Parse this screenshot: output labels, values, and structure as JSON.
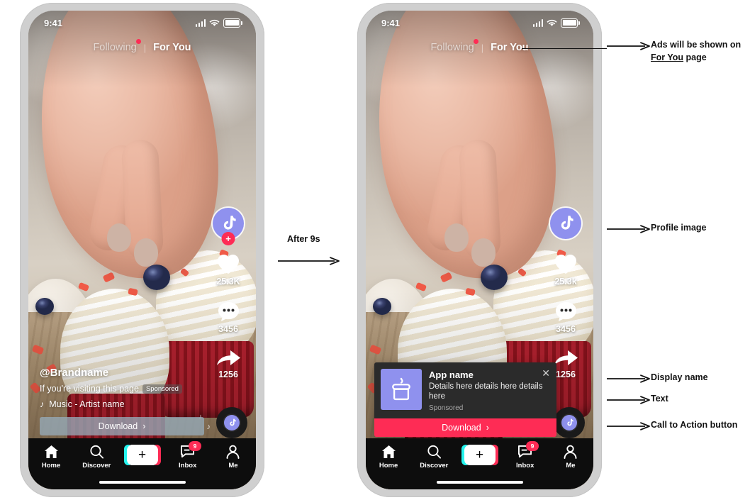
{
  "title": "TikTok in-feed ad spec mockup",
  "transition": {
    "label": "After 9s"
  },
  "phones": [
    {
      "id": "before",
      "status_bar": {
        "time": "9:41",
        "signal_icon": "signal-bars-icon",
        "wifi_icon": "wifi-icon",
        "battery_icon": "battery-icon"
      },
      "top_tabs": {
        "inactive": "Following",
        "separator": "|",
        "active": "For You",
        "badge_dot": true
      },
      "rail": {
        "avatar_icon": "tiktok-note-icon",
        "follow_plus": "+",
        "like_icon": "heart-icon",
        "like_count": "25.3K",
        "comment_icon": "comment-dots-icon",
        "comment_count": "3456",
        "share_icon": "share-arrow-icon",
        "share_count": "1256",
        "disc_icon": "music-disc-icon"
      },
      "caption": {
        "username": "@Brandname",
        "description": "If you're visiting this page",
        "sponsored_tag": "Sponsored",
        "music_icon": "music-note-icon",
        "music": "Music - Artist name",
        "cta_label": "Download",
        "cta_chevron": "›"
      },
      "ad_card": null
    },
    {
      "id": "after",
      "status_bar": {
        "time": "9:41",
        "signal_icon": "signal-bars-icon",
        "wifi_icon": "wifi-icon",
        "battery_icon": "battery-icon"
      },
      "top_tabs": {
        "inactive": "Following",
        "separator": "|",
        "active": "For You",
        "badge_dot": true
      },
      "rail": {
        "avatar_icon": "tiktok-note-icon",
        "follow_plus": "",
        "like_icon": "heart-icon",
        "like_count": "25.3k",
        "comment_icon": "comment-dots-icon",
        "comment_count": "3456",
        "share_icon": "share-arrow-icon",
        "share_count": "1256",
        "disc_icon": "music-disc-icon"
      },
      "caption": null,
      "ad_card": {
        "app_icon": "cake-icon",
        "app_name": "App name",
        "details": "Details here details here details here",
        "sponsored": "Sponsored",
        "close_icon": "close-icon",
        "cta_label": "Download",
        "cta_chevron": "›"
      }
    }
  ],
  "bottom_nav": [
    {
      "icon": "home-icon",
      "label": "Home",
      "badge": ""
    },
    {
      "icon": "search-icon",
      "label": "Discover",
      "badge": ""
    },
    {
      "icon": "plus-icon",
      "label": "",
      "badge": ""
    },
    {
      "icon": "inbox-message-icon",
      "label": "Inbox",
      "badge": "9"
    },
    {
      "icon": "person-icon",
      "label": "Me",
      "badge": ""
    }
  ],
  "annotations": [
    {
      "id": "for-you-page",
      "line1": "Ads will be shown on",
      "line2_underline": "For You",
      "line2_rest": " page"
    },
    {
      "id": "profile-image",
      "line1": "Profile image",
      "line2_underline": "",
      "line2_rest": ""
    },
    {
      "id": "display-name",
      "line1": "Display name",
      "line2_underline": "",
      "line2_rest": ""
    },
    {
      "id": "text",
      "line1": "Text",
      "line2_underline": "",
      "line2_rest": ""
    },
    {
      "id": "cta-button",
      "line1": "Call to Action button",
      "line2_underline": "",
      "line2_rest": ""
    }
  ],
  "colors": {
    "accent_red": "#fe2c55",
    "accent_cyan": "#25f4ee",
    "periwinkle": "#8f91ee",
    "nav_bg": "#0d0d0d",
    "card_bg": "#2b2b2b",
    "phone_frame": "#cfcfcf"
  }
}
